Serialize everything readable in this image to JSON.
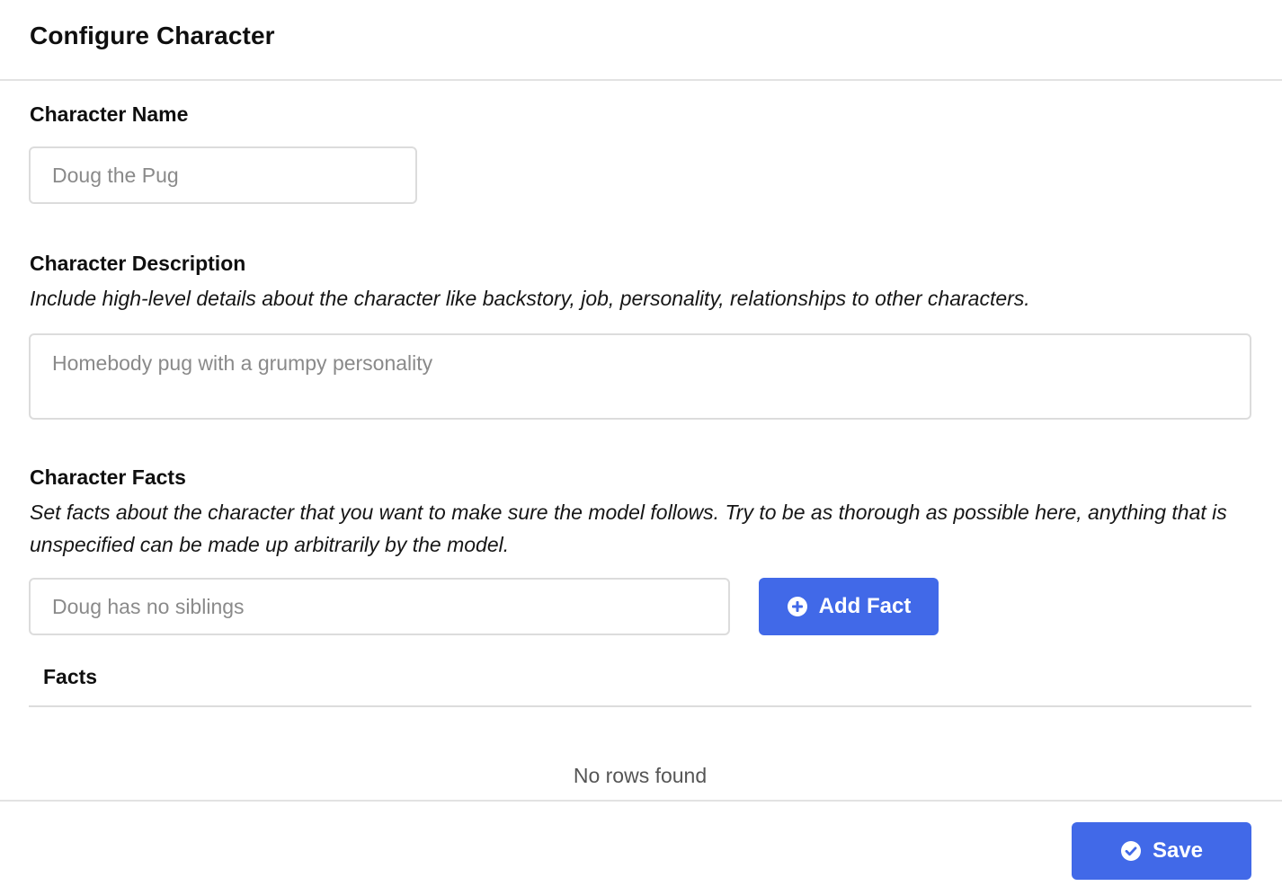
{
  "header": {
    "title": "Configure Character"
  },
  "name_section": {
    "label": "Character Name",
    "input": {
      "value": "",
      "placeholder": "Doug the Pug"
    }
  },
  "description_section": {
    "label": "Character Description",
    "help": "Include high-level details about the character like backstory, job, personality, relationships to other characters.",
    "input": {
      "value": "",
      "placeholder": "Homebody pug with a grumpy personality"
    }
  },
  "facts_section": {
    "label": "Character Facts",
    "help": "Set facts about the character that you want to make sure the model follows. Try to be as thorough as possible here, anything that is unspecified can be made up arbitrarily by the model.",
    "input": {
      "value": "",
      "placeholder": "Doug has no siblings"
    },
    "add_button": {
      "label": "Add Fact",
      "icon": "plus-circle-icon"
    },
    "table": {
      "column_header": "Facts",
      "rows": [],
      "empty_text": "No rows found"
    }
  },
  "footer": {
    "save_button": {
      "label": "Save",
      "icon": "check-circle-icon"
    }
  },
  "colors": {
    "accent": "#4169e8",
    "border": "#dcdcdc",
    "placeholder": "#8a8a8a"
  }
}
